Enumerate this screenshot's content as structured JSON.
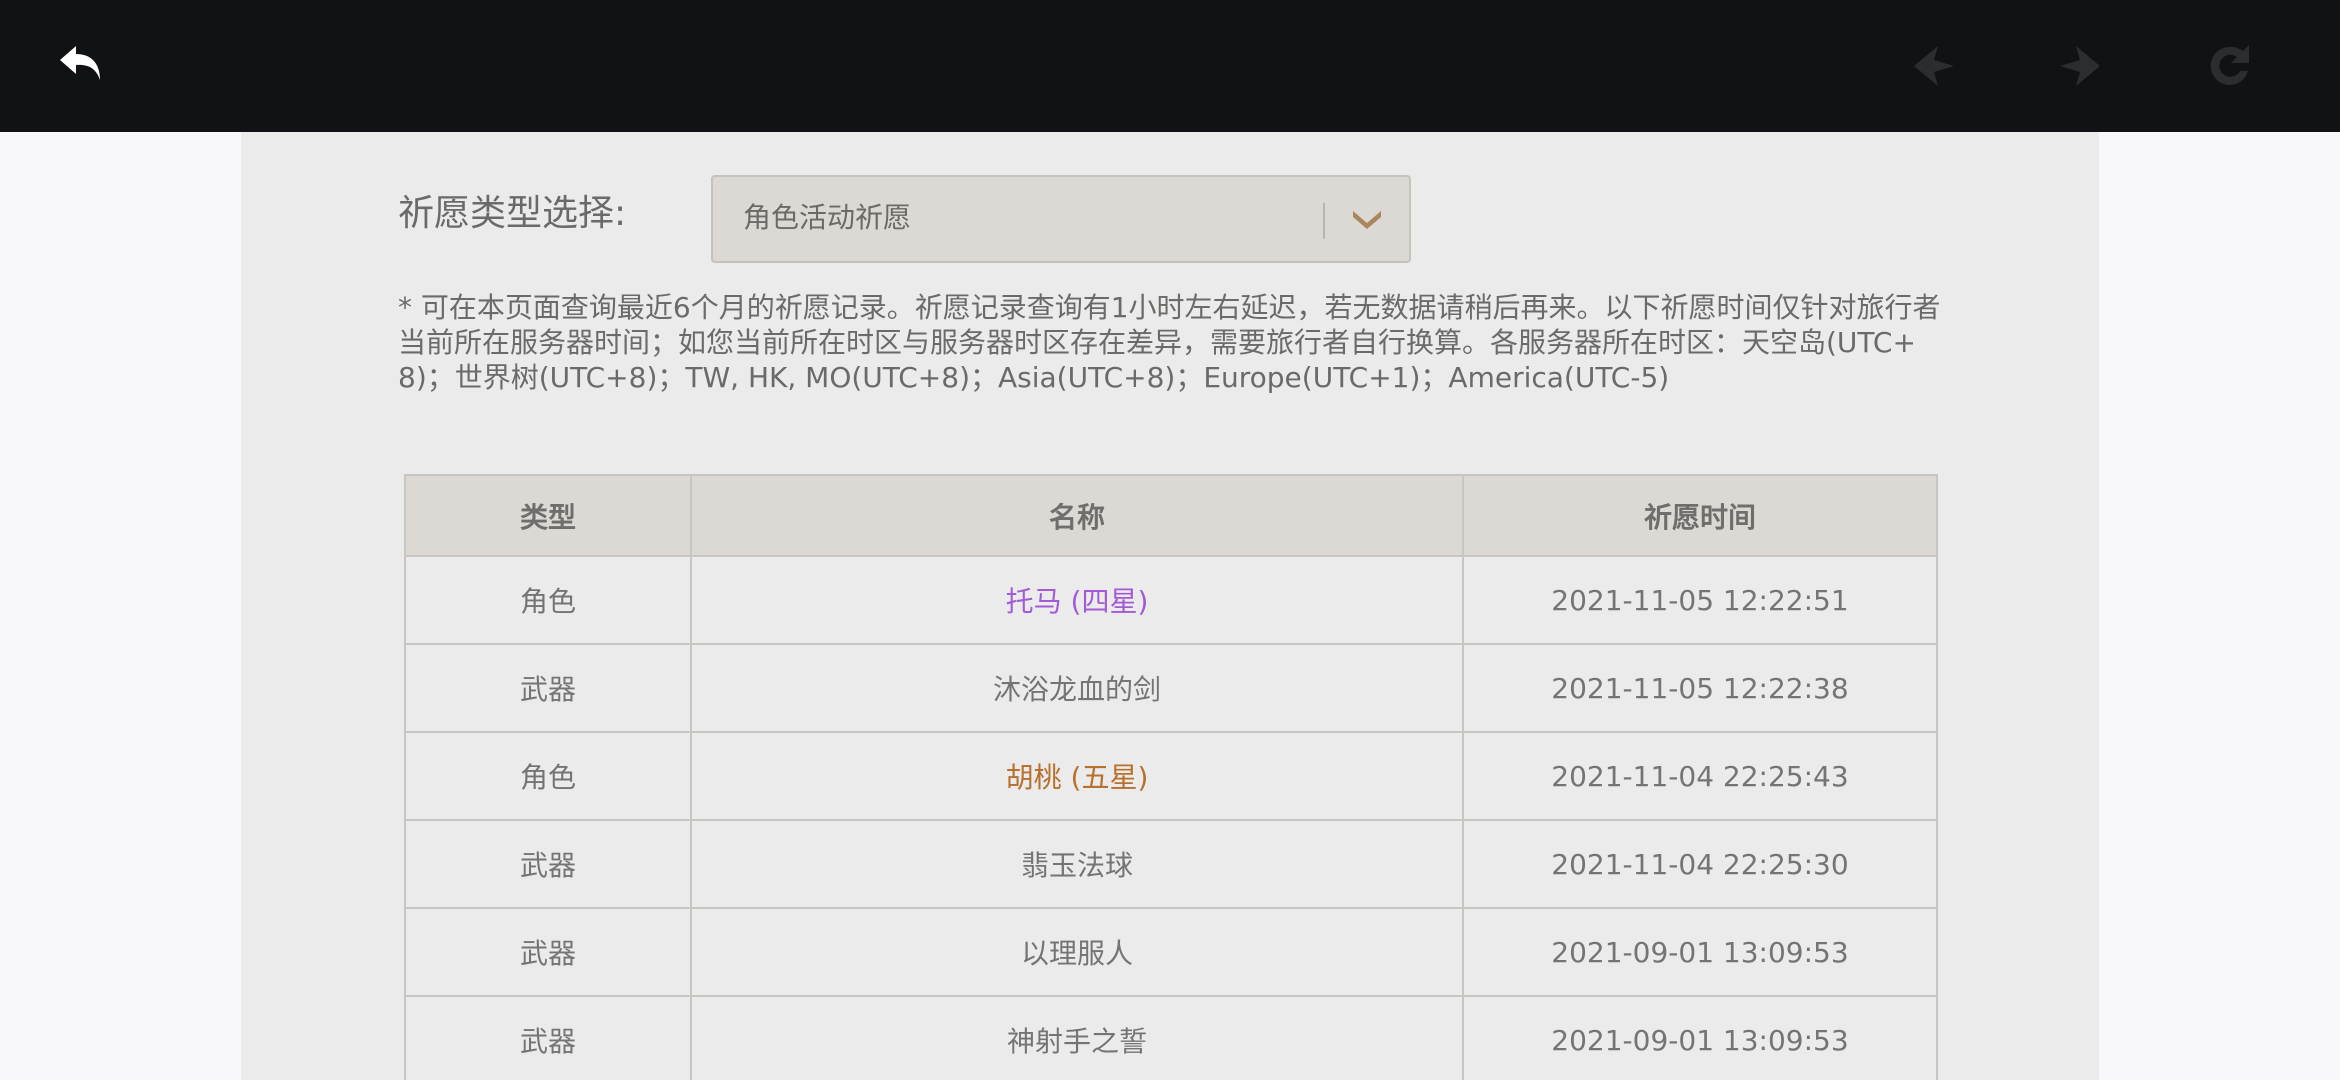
{
  "toolbar": {
    "back_icon": "back-arrow-icon",
    "prev_icon": "chevron-left-icon",
    "next_icon": "chevron-right-icon",
    "refresh_icon": "refresh-icon",
    "background_color": "#111215"
  },
  "filter": {
    "label": "祈愿类型选择:",
    "selected": "角色活动祈愿"
  },
  "notice": "* 可在本页面查询最近6个月的祈愿记录。祈愿记录查询有1小时左右延迟，若无数据请稍后再来。以下祈愿时间仅针对旅行者当前所在服务器时间；如您当前所在时区与服务器时区存在差异，需要旅行者自行换算。各服务器所在时区：天空岛(UTC+8)；世界树(UTC+8)；TW, HK, MO(UTC+8)；Asia(UTC+8)；Europe(UTC+1)；America(UTC-5)",
  "table": {
    "headers": [
      "类型",
      "名称",
      "祈愿时间"
    ],
    "rows": [
      {
        "type": "角色",
        "name": "托马 (四星)",
        "time": "2021-11-05 12:22:51",
        "rarity": "four-star"
      },
      {
        "type": "武器",
        "name": "沐浴龙血的剑",
        "time": "2021-11-05 12:22:38",
        "rarity": "three-star"
      },
      {
        "type": "角色",
        "name": "胡桃 (五星)",
        "time": "2021-11-04 22:25:43",
        "rarity": "five-star"
      },
      {
        "type": "武器",
        "name": "翡玉法球",
        "time": "2021-11-04 22:25:30",
        "rarity": "three-star"
      },
      {
        "type": "武器",
        "name": "以理服人",
        "time": "2021-09-01 13:09:53",
        "rarity": "three-star"
      },
      {
        "type": "武器",
        "name": "神射手之誓",
        "time": "2021-09-01 13:09:53",
        "rarity": "three-star"
      }
    ]
  },
  "colors": {
    "four_star": "#a25ad7",
    "five_star": "#b8702d",
    "text": "#757472"
  }
}
